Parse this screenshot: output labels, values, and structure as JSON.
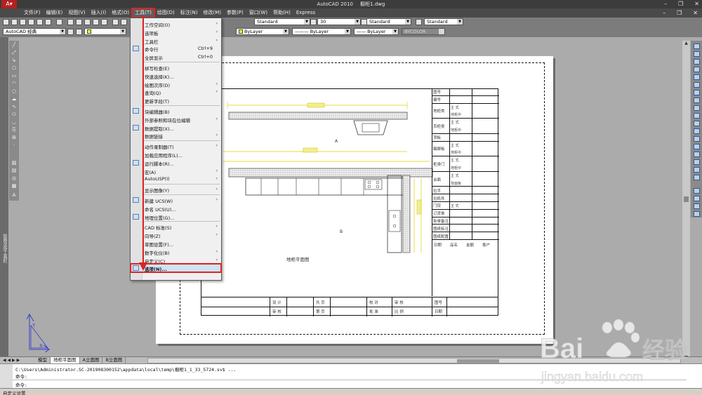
{
  "window": {
    "app_title": "AutoCAD 2010",
    "doc_title": "橱柜1.dwg",
    "btn_min": "–",
    "btn_max": "❐",
    "btn_close": "✕"
  },
  "menubar": {
    "items": [
      "文件(F)",
      "编辑(E)",
      "视图(V)",
      "插入(I)",
      "格式(O)",
      "工具(T)",
      "绘图(D)",
      "标注(N)",
      "修改(M)",
      "参数(P)",
      "窗口(W)",
      "帮助(H)",
      "Express"
    ],
    "active_index": 5,
    "right_controls": [
      "–",
      "❐",
      "✕"
    ]
  },
  "toolbar": {
    "workspace": "AutoCAD 经典",
    "text_style": "Standard",
    "scale": "30",
    "dim_style": "Standard",
    "table_style": "Standard",
    "layer_color": "ByLayer",
    "linetype": "ByLayer",
    "lineweight": "ByLayer",
    "plot_style": "BYCOLOR"
  },
  "tools_menu": {
    "items": [
      {
        "label": "工作空间(O)",
        "arrow": true,
        "shortcut": ""
      },
      {
        "label": "选项板",
        "arrow": true,
        "shortcut": ""
      },
      {
        "label": "工具栏",
        "arrow": true,
        "shortcut": ""
      },
      {
        "label": "命令行",
        "arrow": false,
        "shortcut": "Ctrl+9"
      },
      {
        "label": "全屏显示",
        "arrow": false,
        "shortcut": "Ctrl+0"
      },
      {
        "label": "拼写检查(E)",
        "arrow": false,
        "shortcut": ""
      },
      {
        "label": "快速选择(K)...",
        "arrow": false,
        "shortcut": ""
      },
      {
        "label": "绘图次序(D)",
        "arrow": true,
        "shortcut": ""
      },
      {
        "label": "查询(Q)",
        "arrow": true,
        "shortcut": ""
      },
      {
        "label": "更新字段(T)",
        "arrow": false,
        "shortcut": ""
      },
      {
        "label": "块编辑器(B)",
        "arrow": false,
        "shortcut": ""
      },
      {
        "label": "外部参照和块在位编辑",
        "arrow": true,
        "shortcut": ""
      },
      {
        "label": "数据提取(X)...",
        "arrow": false,
        "shortcut": ""
      },
      {
        "label": "数据链接",
        "arrow": true,
        "shortcut": ""
      },
      {
        "label": "动作录制器(T)",
        "arrow": true,
        "shortcut": ""
      },
      {
        "label": "加载应用程序(L)...",
        "arrow": false,
        "shortcut": ""
      },
      {
        "label": "运行脚本(R)...",
        "arrow": false,
        "shortcut": ""
      },
      {
        "label": "宏(A)",
        "arrow": true,
        "shortcut": ""
      },
      {
        "label": "AutoLISP(I)",
        "arrow": true,
        "shortcut": ""
      },
      {
        "label": "显示图像(Y)",
        "arrow": true,
        "shortcut": ""
      },
      {
        "label": "新建 UCS(W)",
        "arrow": true,
        "shortcut": ""
      },
      {
        "label": "命名 UCS(U)...",
        "arrow": false,
        "shortcut": ""
      },
      {
        "label": "地理位置(G)...",
        "arrow": false,
        "shortcut": ""
      },
      {
        "label": "CAD 标准(S)",
        "arrow": true,
        "shortcut": ""
      },
      {
        "label": "向导(Z)",
        "arrow": true,
        "shortcut": ""
      },
      {
        "label": "草图设置(F)...",
        "arrow": false,
        "shortcut": ""
      },
      {
        "label": "数字化仪(B)",
        "arrow": true,
        "shortcut": ""
      },
      {
        "label": "自定义(C)",
        "arrow": true,
        "shortcut": ""
      },
      {
        "label": "选项(N)...",
        "arrow": false,
        "shortcut": ""
      }
    ],
    "highlighted_label": "选项(N)..."
  },
  "drawing": {
    "plan_title": "地柜平面图",
    "mark_a": "A",
    "mark_b": "B",
    "titleblock": [
      {
        "label": "图号"
      },
      {
        "label": "编号"
      },
      {
        "label": "地柜类",
        "subs": [
          "主 式",
          "地柜中"
        ]
      },
      {
        "label": "吊柜类",
        "subs": [
          "主 式",
          "地柜中"
        ]
      },
      {
        "label": "顶板"
      },
      {
        "label": "踢脚板",
        "subs": [
          "主 式",
          "地柜中"
        ]
      },
      {
        "label": "柜身门",
        "subs": [
          "主 式",
          "地柜中"
        ]
      },
      {
        "label": "台面",
        "subs": [
          "主 式",
          "背面板"
        ]
      },
      {
        "label": "拉手"
      },
      {
        "label": "拉机件"
      },
      {
        "label": "门铰",
        "subs": [
          "主 式"
        ]
      },
      {
        "label": "订货单"
      },
      {
        "label": "拆单备注"
      },
      {
        "label": "图纸标注"
      },
      {
        "label": "图纸配置"
      }
    ],
    "bottom_labels": [
      "设 计",
      "审 核",
      "共 页",
      "第 页",
      "校 对",
      "批 准",
      "审 核",
      "比 例",
      "图号",
      "日期"
    ],
    "tb_footer": [
      "日期",
      "品名",
      "金额",
      "客户"
    ]
  },
  "layout_tabs": {
    "nav": "◀ ◀ ▶ ▶",
    "tabs": [
      "模型",
      "地柜平面图",
      "A立面图",
      "B立面图"
    ],
    "current_index": 1
  },
  "command": {
    "history": "C:\\Users\\Administrator.SC-201908300152\\appdata\\local\\temp\\橱柜1_1_33_5724.sv$ ...",
    "line1": "命令:",
    "line2": "命令:"
  },
  "statusbar": {
    "text": "自定义设置"
  },
  "side_label": "绘图次序工具栏",
  "watermark": {
    "brand_left": "Bai",
    "brand_right": "经验",
    "url": "jingyan.baidu.com"
  }
}
